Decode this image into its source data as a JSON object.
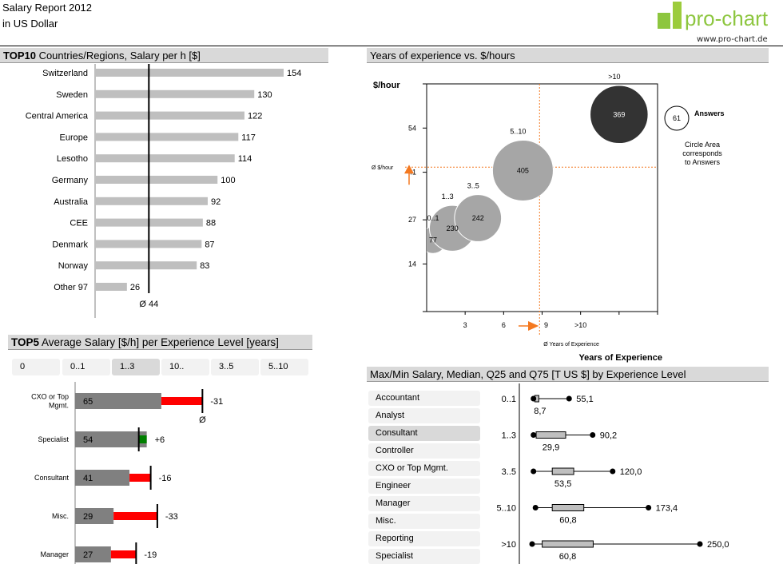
{
  "header": {
    "title": "Salary Report 2012",
    "subtitle": "in US Dollar",
    "logo_text": "pro-chart",
    "logo_url": "www.pro-chart.de",
    "brand_color": "#8dc63f"
  },
  "chart_data": [
    {
      "id": "top10",
      "type": "bar",
      "title_bold": "TOP10",
      "title": " Countries/Regions, Salary per h [$]",
      "categories": [
        "Switzerland",
        "Sweden",
        "Central America",
        "Europe",
        "Lesotho",
        "Germany",
        "Australia",
        "CEE",
        "Denmark",
        "Norway",
        "Other 97"
      ],
      "values": [
        154,
        130,
        122,
        117,
        114,
        100,
        92,
        88,
        87,
        83,
        26
      ],
      "average": 44,
      "average_label": "Ø 44",
      "bar_color": "#bfbfbf"
    },
    {
      "id": "bubble",
      "type": "scatter",
      "title": "Years of experience vs. $/hours",
      "ylabel": "$/hour",
      "xlabel": "Years of Experience",
      "y_ticks": [
        "54",
        "41",
        "27",
        "14"
      ],
      "y_tick_values": [
        54,
        41,
        27,
        14
      ],
      "x_ticks": [
        "3",
        "6",
        "9",
        ">10"
      ],
      "x_tick_values": [
        3,
        6,
        9,
        12
      ],
      "xlim": [
        0,
        18
      ],
      "ylim": [
        0,
        67
      ],
      "avg_y_label": "Ø $/hour",
      "avg_x_label": "Ø Years of Experience",
      "avg_y": 42.5,
      "avg_x": 8.8,
      "points": [
        {
          "label": "0..1",
          "x": 0.5,
          "y": 21,
          "answers": 77,
          "color": "#a6a6a6"
        },
        {
          "label": "1..3",
          "x": 2,
          "y": 24.5,
          "answers": 230,
          "color": "#a6a6a6"
        },
        {
          "label": "3..5",
          "x": 4,
          "y": 27.5,
          "answers": 242,
          "color": "#a6a6a6"
        },
        {
          "label": "5..10",
          "x": 7.5,
          "y": 41.5,
          "answers": 405,
          "color": "#a6a6a6"
        },
        {
          "label": ">10",
          "x": 15,
          "y": 58,
          "answers": 369,
          "color": "#333333"
        }
      ],
      "legend": {
        "value": "61",
        "label": "Answers",
        "note": "Circle Area corresponds to Answers"
      },
      "accent_color": "#f47920"
    },
    {
      "id": "top5",
      "type": "bar",
      "title_bold": "TOP5",
      "title": " Average Salary [$/h] per Experience Level [years]",
      "tabs": [
        "0",
        "0..1",
        "1..3",
        "10..",
        "3..5",
        "5..10"
      ],
      "active_tab": "1..3",
      "categories": [
        "CXO or Top Mgmt.",
        "Specialist",
        "Consultant",
        "Misc.",
        "Manager"
      ],
      "category_display": [
        [
          "CXO or Top",
          "Mgmt."
        ],
        [
          "Specialist"
        ],
        [
          "Consultant"
        ],
        [
          "Misc."
        ],
        [
          "Manager"
        ]
      ],
      "values": [
        65,
        54,
        41,
        29,
        27
      ],
      "deltas": [
        -31,
        6,
        -16,
        -33,
        -19
      ],
      "delta_labels": [
        "-31",
        "+6",
        "-16",
        "-33",
        "-19"
      ],
      "average_marker": "Ø",
      "colors": {
        "bar": "#808080",
        "negative": "#ff0000",
        "positive": "#008000"
      }
    },
    {
      "id": "boxplot",
      "type": "box",
      "title": "Max/Min Salary, Median, Q25 and Q75 [T US $] by Experience Level",
      "job_categories": [
        "Accountant",
        "Analyst",
        "Consultant",
        "Controller",
        "CXO or Top Mgmt.",
        "Engineer",
        "Manager",
        "Misc.",
        "Reporting",
        "Specialist"
      ],
      "active_category": "Consultant",
      "levels": [
        "0..1",
        "1..3",
        "3..5",
        "5..10",
        ">10"
      ],
      "rows": [
        {
          "level": "0..1",
          "min": 2,
          "q25": 4,
          "q75": 10,
          "max": 55.1,
          "median_label": "8,7",
          "max_label": "55,1"
        },
        {
          "level": "1..3",
          "min": 2,
          "q25": 6,
          "q75": 50,
          "max": 90.2,
          "median_label": "29,9",
          "max_label": "90,2"
        },
        {
          "level": "3..5",
          "min": 2,
          "q25": 30,
          "q75": 62,
          "max": 120.0,
          "median_label": "53,5",
          "max_label": "120,0"
        },
        {
          "level": "5..10",
          "min": 5,
          "q25": 30,
          "q75": 77,
          "max": 173.4,
          "median_label": "60,8",
          "max_label": "173,4"
        },
        {
          "level": ">10",
          "min": 0,
          "q25": 15,
          "q75": 91,
          "max": 250.0,
          "median_label": "60,8",
          "max_label": "250,0"
        }
      ],
      "xlim": [
        0,
        250
      ]
    }
  ]
}
